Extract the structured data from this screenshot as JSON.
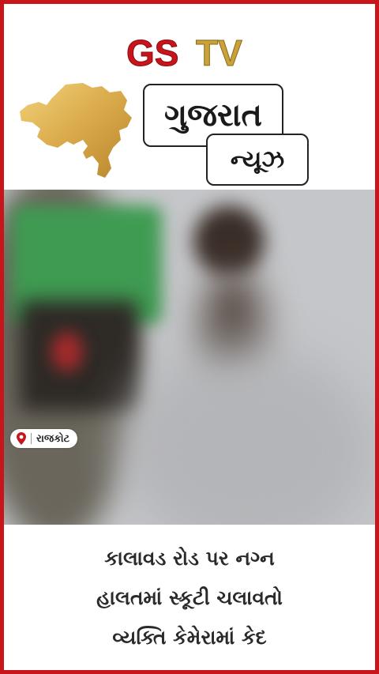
{
  "brand": {
    "logo_part1": "GS",
    "logo_part2": "TV",
    "primary_color": "#c8141b",
    "gold_color": "#c9a23a"
  },
  "header": {
    "title": "ગુજરાત",
    "subtitle": "ન્યૂઝ"
  },
  "location": {
    "icon": "map-pin-icon",
    "label": "રાજકોટ"
  },
  "headline": {
    "lines": [
      "કાલાવડ રોડ પર નગ્ન",
      "હાલતમાં સ્કૂટી ચલાવતો",
      "વ્યક્તિ કેમેરામાં કેદ"
    ]
  }
}
